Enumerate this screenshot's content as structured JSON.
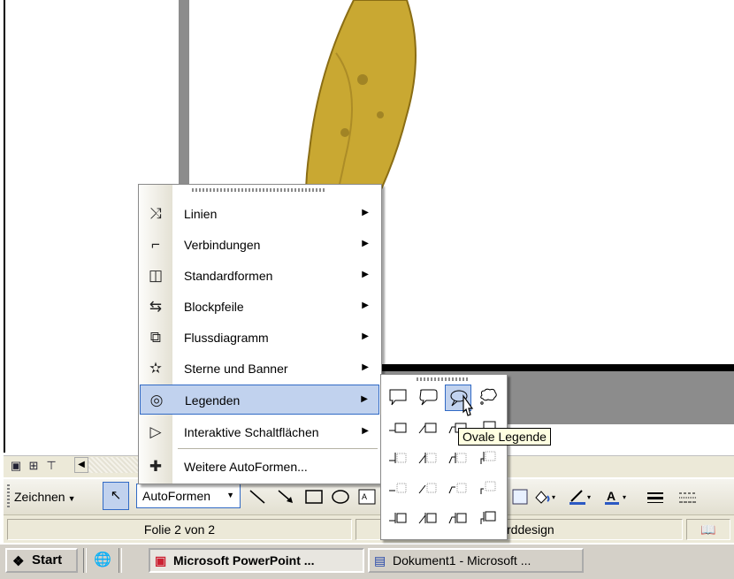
{
  "draw_toolbar": {
    "zeichnen_label": "Zeichnen",
    "autoformen_label": "AutoFormen"
  },
  "menu": {
    "items": [
      {
        "label": "Linien",
        "icon": "lines-icon"
      },
      {
        "label": "Verbindungen",
        "icon": "connectors-icon"
      },
      {
        "label": "Standardformen",
        "icon": "basic-shapes-icon"
      },
      {
        "label": "Blockpfeile",
        "icon": "block-arrows-icon"
      },
      {
        "label": "Flussdiagramm",
        "icon": "flowchart-icon"
      },
      {
        "label": "Sterne und Banner",
        "icon": "stars-banners-icon"
      },
      {
        "label": "Legenden",
        "icon": "callouts-icon"
      },
      {
        "label": "Interaktive Schaltflächen",
        "icon": "action-buttons-icon"
      },
      {
        "label": "Weitere AutoFormen...",
        "icon": "more-autoshapes-icon"
      }
    ],
    "highlighted": "Legenden"
  },
  "submenu": {
    "title": "Legenden",
    "highlighted_item": "Ovale Legende",
    "tooltip": "Ovale Legende"
  },
  "status_bar": {
    "slide_info": "Folie 2 von 2",
    "design": "rddesign"
  },
  "taskbar": {
    "start_label": "Start",
    "task_powerpoint": "Microsoft PowerPoint ...",
    "task_word": "Dokument1 - Microsoft ..."
  },
  "colors": {
    "highlight": "#c1d2ee",
    "highlight_border": "#316ac5",
    "tooltip_bg": "#ffffe1",
    "toolbar_bg": "#ece9d8"
  }
}
